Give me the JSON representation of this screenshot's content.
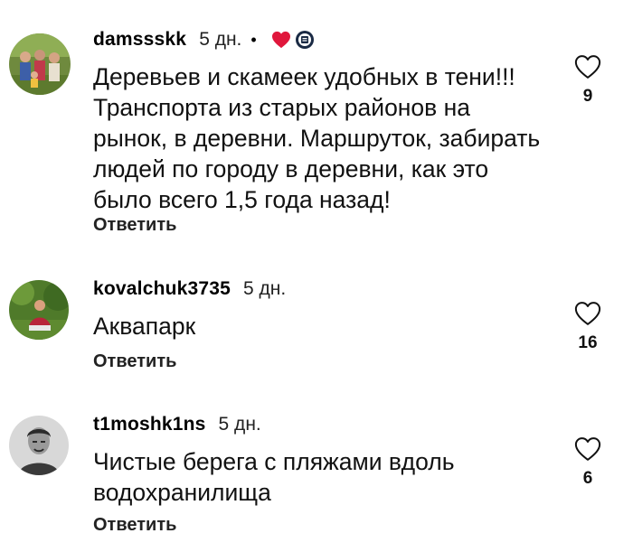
{
  "comments": [
    {
      "username": "damssskk",
      "time": "5 дн.",
      "dot": "•",
      "text": "Деревьев и скамеек удобных в тени!!! Транспорта из старых районов на рынок, в деревни. Маршруток, забирать людей по городу в деревни, как это было всего 1,5 года назад!",
      "reply_label": "Ответить",
      "likes": "9",
      "liked_by_creator": true,
      "avatar_icon": "family-photo-avatar"
    },
    {
      "username": "kovalchuk3735",
      "time": "5 дн.",
      "text": "Аквапарк",
      "reply_label": "Ответить",
      "likes": "16",
      "avatar_icon": "person-in-garden-avatar"
    },
    {
      "username": "t1moshk1ns",
      "time": "5 дн.",
      "text": "Чистые берега с пляжами вдоль водохранилища",
      "reply_label": "Ответить",
      "likes": "6",
      "avatar_icon": "bw-portrait-avatar"
    }
  ],
  "colors": {
    "heart_badge": "#e0173c",
    "text": "#111111",
    "background": "#ffffff"
  }
}
